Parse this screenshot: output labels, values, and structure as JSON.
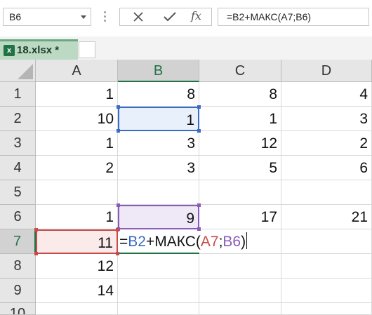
{
  "name_box": {
    "value": "B6"
  },
  "formula_bar": {
    "fx_label": "fx",
    "formula": "=B2+МАКС(A7;B6)"
  },
  "file_tab": {
    "name": "18.xlsx *",
    "icon": "excel-file-icon"
  },
  "columns": [
    "A",
    "B",
    "C",
    "D"
  ],
  "active_column": "B",
  "rows": [
    {
      "label": "1",
      "cells": [
        "1",
        "8",
        "8",
        "4"
      ]
    },
    {
      "label": "2",
      "cells": [
        "10",
        "1",
        "1",
        "3"
      ]
    },
    {
      "label": "3",
      "cells": [
        "1",
        "3",
        "12",
        "2"
      ]
    },
    {
      "label": "4",
      "cells": [
        "2",
        "3",
        "5",
        "6"
      ]
    },
    {
      "label": "5",
      "cells": [
        "",
        "",
        "",
        ""
      ]
    },
    {
      "label": "6",
      "cells": [
        "1",
        "9",
        "17",
        "21"
      ]
    },
    {
      "label": "7",
      "cells": [
        "11",
        "",
        "",
        ""
      ]
    },
    {
      "label": "8",
      "cells": [
        "12",
        "",
        "",
        ""
      ]
    },
    {
      "label": "9",
      "cells": [
        "14",
        "",
        "",
        ""
      ]
    },
    {
      "label": "10",
      "cells": [
        "",
        "",
        "",
        ""
      ]
    }
  ],
  "active_row": "7",
  "edit_formula_parts": [
    {
      "text": "=",
      "role": "eq"
    },
    {
      "text": "B2",
      "role": "b2"
    },
    {
      "text": "+МАКС(",
      "role": "plain"
    },
    {
      "text": "A7",
      "role": "a7"
    },
    {
      "text": ";",
      "role": "plain"
    },
    {
      "text": "B6",
      "role": "b6"
    },
    {
      "text": ")",
      "role": "plain"
    }
  ],
  "colors": {
    "accent": "#217346",
    "ref_b2": "#3b6bc4",
    "ref_a7": "#c84a4a",
    "ref_b6": "#8a5bb8"
  }
}
